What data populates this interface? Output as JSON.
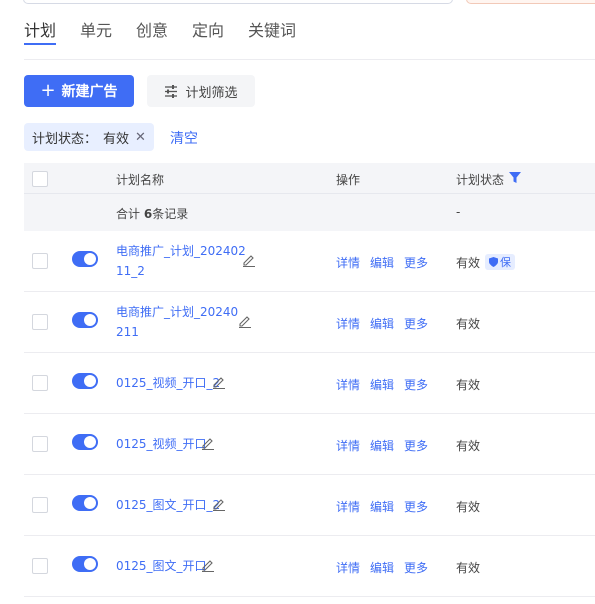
{
  "tabs": [
    "计划",
    "单元",
    "创意",
    "定向",
    "关键词"
  ],
  "toolbar": {
    "new_ad": "新建广告",
    "filter": "计划筛选"
  },
  "filter": {
    "label": "计划状态：",
    "value": "有效",
    "clear": "清空"
  },
  "table": {
    "col_name": "计划名称",
    "col_ops": "操作",
    "col_status": "计划状态",
    "summary": {
      "prefix": "合计",
      "count": "6",
      "suffix": "条记录",
      "status": "-"
    },
    "rows": [
      {
        "name1": "电商推广_计划_202402",
        "name2": "11_2",
        "status": "有效",
        "badge": "保"
      },
      {
        "name1": "电商推广_计划_20240",
        "name2": "211",
        "status": "有效"
      },
      {
        "name1": "0125_视频_开口_2",
        "status": "有效"
      },
      {
        "name1": "0125_视频_开口",
        "status": "有效"
      },
      {
        "name1": "0125_图文_开口_2",
        "status": "有效"
      },
      {
        "name1": "0125_图文_开口",
        "status": "有效"
      }
    ],
    "ops": {
      "detail": "详情",
      "edit": "编辑",
      "more": "更多"
    }
  },
  "colors": {
    "accent": "#3f6df5"
  }
}
